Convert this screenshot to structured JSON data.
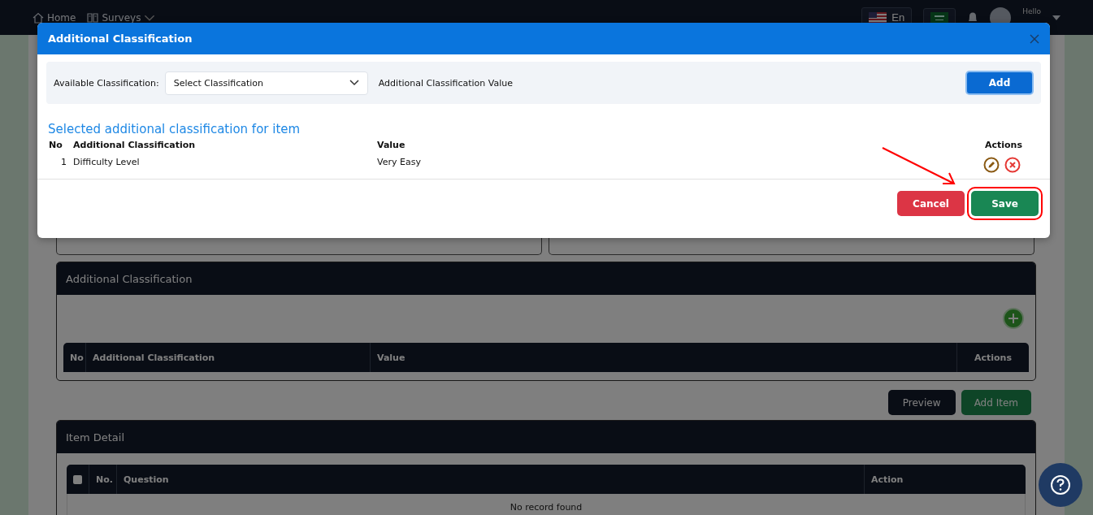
{
  "nav": {
    "links": [
      {
        "label": "Home"
      },
      {
        "label": "Surveys"
      }
    ],
    "languages": [
      {
        "label": "En"
      }
    ],
    "greeting": "Hello"
  },
  "page": {
    "classification_card": {
      "title": "Additional Classification",
      "columns": [
        "No",
        "Additional Classification",
        "Value",
        "Actions"
      ]
    },
    "buttons": [
      {
        "label": "Preview",
        "kind": "secondary"
      },
      {
        "label": "Add Item",
        "kind": "primary"
      }
    ],
    "item_detail": {
      "title": "Item Detail",
      "select_all_checked": false,
      "columns": [
        "No.",
        "Question",
        "Action"
      ],
      "empty_text": "No record found"
    }
  },
  "modal": {
    "title": "Additional Classification",
    "available_label": "Available Classification:",
    "select": {
      "placeholder": "Select Classification"
    },
    "value_label": "Additional Classification Value",
    "add_button": "Add",
    "section_title": "Selected additional classification for item",
    "columns": [
      "No",
      "Additional Classification",
      "Value",
      "Actions"
    ],
    "rows": [
      {
        "no": "1",
        "classification": "Difficulty Level",
        "value": "Very Easy"
      }
    ],
    "buttons": [
      {
        "label": "Cancel",
        "kind": "danger",
        "highlighted": false
      },
      {
        "label": "Save",
        "kind": "success",
        "highlighted": true
      }
    ]
  }
}
